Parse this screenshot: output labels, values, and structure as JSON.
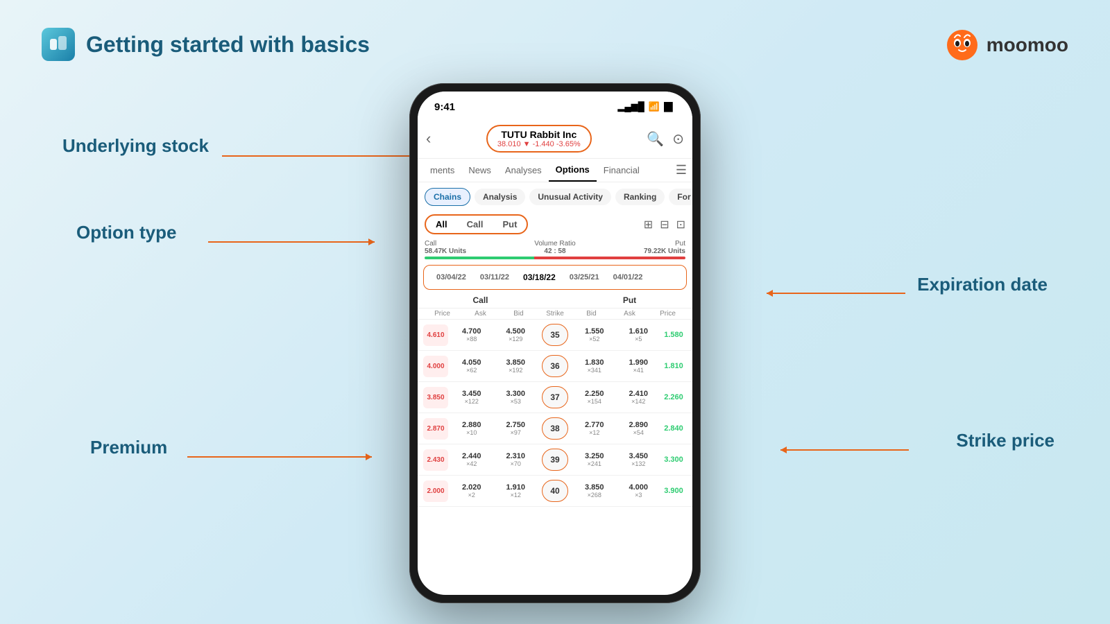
{
  "header": {
    "title": "Getting started with basics",
    "icon_color": "#5bc8dc"
  },
  "moomoo": {
    "text": "moomoo"
  },
  "annotations": {
    "underlying_stock": "Underlying stock",
    "option_type": "Option type",
    "premium": "Premium",
    "expiration_date": "Expiration date",
    "strike_price": "Strike price"
  },
  "phone": {
    "status_time": "9:41",
    "stock": {
      "name": "TUTU Rabbit Inc",
      "price": "38.010",
      "change": "-1.440",
      "pct": "-3.65%"
    },
    "nav_tabs": [
      "ments",
      "News",
      "Analyses",
      "Options",
      "Financial"
    ],
    "active_nav": "Options",
    "filter_pills": [
      "Chains",
      "Analysis",
      "Unusual Activity",
      "Ranking",
      "For"
    ],
    "active_filter": "Chains",
    "option_types": [
      "All",
      "Call",
      "Put"
    ],
    "active_option_type": "All",
    "volume": {
      "call_label": "Call",
      "call_units": "58.47K Units",
      "ratio_label": "Volume Ratio",
      "ratio_value": "42 : 58",
      "put_label": "Put",
      "put_units": "79.22K Units"
    },
    "exp_dates": [
      "03/04/22",
      "03/11/22",
      "03/18/22",
      "03/25/21",
      "04/01/22"
    ],
    "active_exp": "03/18/22",
    "col_headers_call": [
      "Price",
      "Ask",
      "Bid"
    ],
    "col_header_strike": "Strike",
    "col_headers_put": [
      "Bid",
      "Ask",
      "Price"
    ],
    "rows": [
      {
        "call_price": "4.610",
        "ask": "4.700",
        "ask_sz": "×88",
        "bid": "4.500",
        "bid_sz": "×129",
        "strike": "35",
        "put_bid": "1.550",
        "put_bid_sz": "×52",
        "put_ask": "1.610",
        "put_ask_sz": "×5",
        "put_price": "1.580"
      },
      {
        "call_price": "4.000",
        "ask": "4.050",
        "ask_sz": "×62",
        "bid": "3.850",
        "bid_sz": "×192",
        "strike": "36",
        "put_bid": "1.830",
        "put_bid_sz": "×341",
        "put_ask": "1.990",
        "put_ask_sz": "×41",
        "put_price": "1.810"
      },
      {
        "call_price": "3.850",
        "ask": "3.450",
        "ask_sz": "×122",
        "bid": "3.300",
        "bid_sz": "×53",
        "strike": "37",
        "put_bid": "2.250",
        "put_bid_sz": "×154",
        "put_ask": "2.410",
        "put_ask_sz": "×142",
        "put_price": "2.260"
      },
      {
        "call_price": "2.870",
        "ask": "2.880",
        "ask_sz": "×10",
        "bid": "2.750",
        "bid_sz": "×97",
        "strike": "38",
        "put_bid": "2.770",
        "put_bid_sz": "×12",
        "put_ask": "2.890",
        "put_ask_sz": "×54",
        "put_price": "2.840"
      },
      {
        "call_price": "2.430",
        "ask": "2.440",
        "ask_sz": "×42",
        "bid": "2.310",
        "bid_sz": "×70",
        "strike": "39",
        "put_bid": "3.250",
        "put_bid_sz": "×241",
        "put_ask": "3.450",
        "put_ask_sz": "×132",
        "put_price": "3.300"
      },
      {
        "call_price": "2.000",
        "ask": "2.020",
        "ask_sz": "×2",
        "bid": "1.910",
        "bid_sz": "×12",
        "strike": "40",
        "put_bid": "3.850",
        "put_bid_sz": "×268",
        "put_ask": "4.000",
        "put_ask_sz": "×3",
        "put_price": "3.900"
      }
    ]
  }
}
